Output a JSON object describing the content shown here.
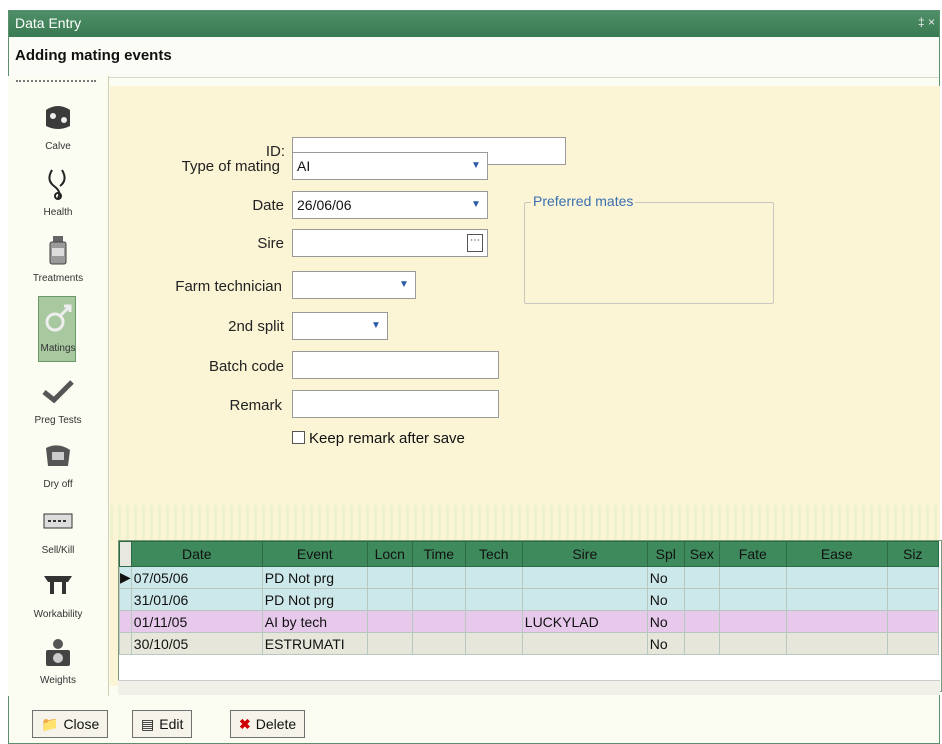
{
  "window": {
    "title": "Data Entry",
    "pin": "‡ ×"
  },
  "page": {
    "heading": "Adding mating events"
  },
  "sidebar": {
    "items": [
      {
        "label": "Calve",
        "icon": "cow-icon"
      },
      {
        "label": "Health",
        "icon": "stethoscope-icon"
      },
      {
        "label": "Treatments",
        "icon": "bottle-icon"
      },
      {
        "label": "Matings",
        "icon": "male-symbol-icon",
        "selected": true
      },
      {
        "label": "Preg Tests",
        "icon": "checkmark-icon"
      },
      {
        "label": "Dry off",
        "icon": "dry-off-icon"
      },
      {
        "label": "Sell/Kill",
        "icon": "tag-icon"
      },
      {
        "label": "Workability",
        "icon": "teats-icon"
      },
      {
        "label": "Weights",
        "icon": "scale-icon"
      }
    ]
  },
  "form": {
    "id_label": "ID:",
    "id_value": "",
    "mating_type_label": "Type of mating",
    "mating_type_value": "AI",
    "date_label": "Date",
    "date_value": "26/06/06",
    "sire_label": "Sire",
    "sire_value": "",
    "tech_label": "Farm technician",
    "tech_value": "",
    "split_label": "2nd split",
    "split_value": "",
    "batch_label": "Batch code",
    "batch_value": "",
    "remark_label": "Remark",
    "remark_value": "",
    "keep_remark_label": "Keep remark after save",
    "preferred_mates_label": "Preferred mates"
  },
  "grid": {
    "columns": [
      "Date",
      "Event",
      "Locn",
      "Time",
      "Tech",
      "Sire",
      "Spl",
      "Sex",
      "Fate",
      "Ease",
      "Siz"
    ],
    "rows": [
      [
        "07/05/06",
        "PD Not prg",
        "",
        "",
        "",
        "",
        "No",
        "",
        "",
        "",
        ""
      ],
      [
        "31/01/06",
        "PD Not prg",
        "",
        "",
        "",
        "",
        "No",
        "",
        "",
        "",
        ""
      ],
      [
        "01/11/05",
        "AI by tech",
        "",
        "",
        "",
        "LUCKYLAD",
        "No",
        "",
        "",
        "",
        ""
      ],
      [
        "30/10/05",
        "ESTRUMATI",
        "",
        "",
        "",
        "",
        "No",
        "",
        "",
        "",
        ""
      ]
    ]
  },
  "buttons": {
    "close": "Close",
    "edit": "Edit",
    "delete": "Delete"
  },
  "colors": {
    "accent": "#3f8a5d",
    "panel": "#fbf5d6",
    "link": "#3a6fb0"
  }
}
